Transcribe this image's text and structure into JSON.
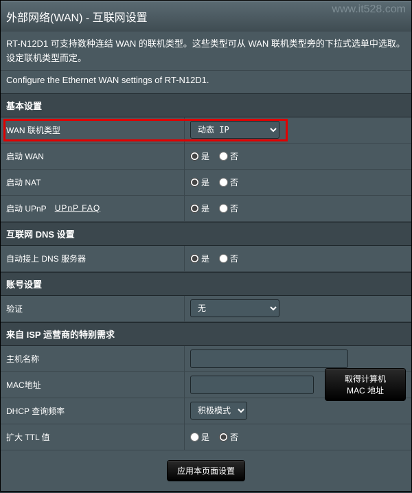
{
  "watermark": "www.it528.com",
  "page_title": "外部网络(WAN) - 互联网设置",
  "intro_line1": "RT-N12D1 可支持数种连结 WAN 的联机类型。这些类型可从 WAN 联机类型旁的下拉式选单中选取。设定联机类型而定。",
  "intro_line2": "Configure the Ethernet WAN settings of RT-N12D1.",
  "radio_yes": "是",
  "radio_no": "否",
  "sections": {
    "basic": {
      "title": "基本设置",
      "wan_type_label": "WAN 联机类型",
      "wan_type_value": "动态 IP",
      "enable_wan_label": "启动 WAN",
      "enable_nat_label": "启动 NAT",
      "enable_upnp_label": "启动 UPnP",
      "upnp_faq_label": "UPnP FAQ"
    },
    "dns": {
      "title": "互联网 DNS 设置",
      "auto_dns_label": "自动接上 DNS 服务器"
    },
    "account": {
      "title": "账号设置",
      "auth_label": "验证",
      "auth_value": "无"
    },
    "isp": {
      "title": "来自 ISP 运营商的特别需求",
      "host_label": "主机名称",
      "host_value": "",
      "mac_label": "MAC地址",
      "mac_value": "",
      "mac_btn": "取得计算机 MAC 地址",
      "dhcp_label": "DHCP 查询频率",
      "dhcp_value": "积极模式",
      "ttl_label": "扩大 TTL 值"
    }
  },
  "apply_btn": "应用本页面设置"
}
